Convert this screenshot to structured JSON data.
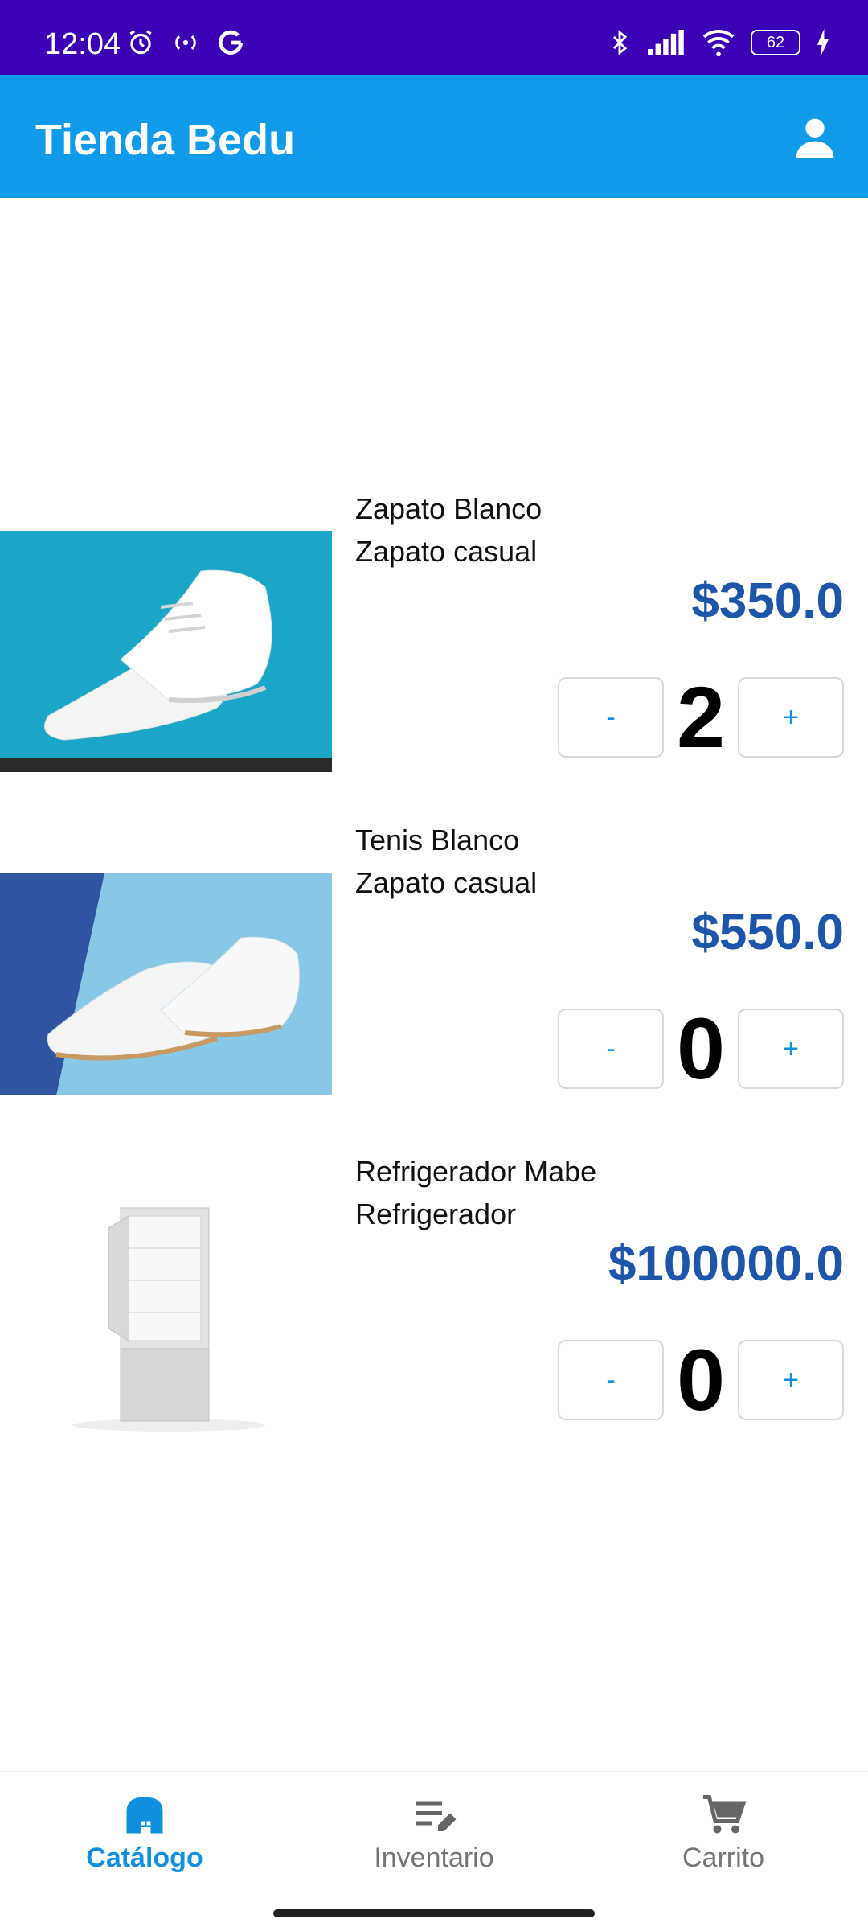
{
  "status_bar": {
    "time": "12:04",
    "battery": "62",
    "left_icons": [
      "alarm-icon",
      "radio-signal-icon",
      "google-icon"
    ],
    "right_icons": [
      "bluetooth-icon",
      "cell-signal-icon",
      "wifi-icon",
      "battery-icon",
      "charging-icon"
    ]
  },
  "app_bar": {
    "title": "Tienda Bedu",
    "account_icon": "person-icon",
    "background": "#0f9bea"
  },
  "products": [
    {
      "name": "Zapato Blanco",
      "description": "Zapato casual",
      "price": "$350.0",
      "quantity": "2",
      "minus_label": "-",
      "plus_label": "+"
    },
    {
      "name": "Tenis Blanco",
      "description": "Zapato casual",
      "price": "$550.0",
      "quantity": "0",
      "minus_label": "-",
      "plus_label": "+"
    },
    {
      "name": "Refrigerador Mabe",
      "description": "Refrigerador",
      "price": "$100000.0",
      "quantity": "0",
      "minus_label": "-",
      "plus_label": "+"
    }
  ],
  "bottom_nav": {
    "items": [
      {
        "label": "Catálogo",
        "icon": "store-icon",
        "active": true
      },
      {
        "label": "Inventario",
        "icon": "edit-list-icon",
        "active": false
      },
      {
        "label": "Carrito",
        "icon": "cart-icon",
        "active": false
      }
    ],
    "active_color": "#0f8fe0"
  }
}
